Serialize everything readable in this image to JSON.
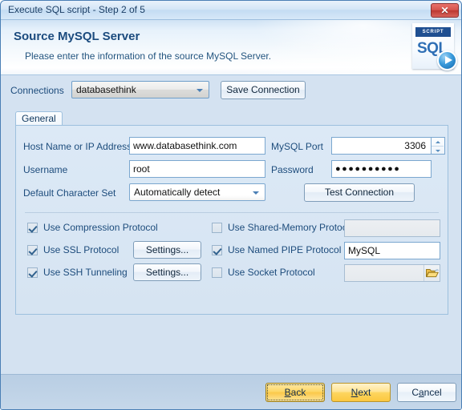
{
  "window": {
    "title": "Execute SQL script - Step 2 of 5",
    "close_label": "✕"
  },
  "header": {
    "title": "Source MySQL Server",
    "subtitle": "Please enter the information of the source MySQL Server.",
    "logo": {
      "banner": "SCRIPT",
      "text": "SQL"
    }
  },
  "connections": {
    "label": "Connections",
    "selected": "databasethink",
    "save_button": "Save Connection"
  },
  "tabs": [
    {
      "label": "General"
    }
  ],
  "general": {
    "host": {
      "label": "Host Name or IP Address",
      "value": "www.databasethink.com"
    },
    "username": {
      "label": "Username",
      "value": "root"
    },
    "charset": {
      "label": "Default Character Set",
      "value": "Automatically detect"
    },
    "port": {
      "label": "MySQL Port",
      "value": "3306"
    },
    "password": {
      "label": "Password",
      "value": "●●●●●●●●●●"
    },
    "test_connection": "Test Connection"
  },
  "protocols": {
    "compression": {
      "label": "Use Compression Protocol",
      "checked": true
    },
    "ssl": {
      "label": "Use SSL Protocol",
      "checked": true,
      "settings_label": "Settings..."
    },
    "ssh": {
      "label": "Use SSH Tunneling",
      "checked": true,
      "settings_label": "Settings..."
    },
    "shared_memory": {
      "label": "Use Shared-Memory Protocol",
      "checked": false,
      "value": ""
    },
    "named_pipe": {
      "label": "Use Named PIPE Protocol",
      "checked": true,
      "value": "MySQL"
    },
    "socket": {
      "label": "Use Socket Protocol",
      "checked": false,
      "value": ""
    }
  },
  "footer": {
    "back": "Back",
    "back_accesskey": "B",
    "back_rest": "ack",
    "next": "Next",
    "next_accesskey": "N",
    "next_rest": "ext",
    "cancel": "Cancel",
    "cancel_first": "C",
    "cancel_accesskey": "a",
    "cancel_rest": "ncel"
  },
  "colors": {
    "accent_blue": "#1b4b7e",
    "panel_bg": "#d4e2f1",
    "titlebar": "#d5e6f7",
    "close_red": "#c8443c",
    "wizard_yellow": "#fdd766"
  }
}
